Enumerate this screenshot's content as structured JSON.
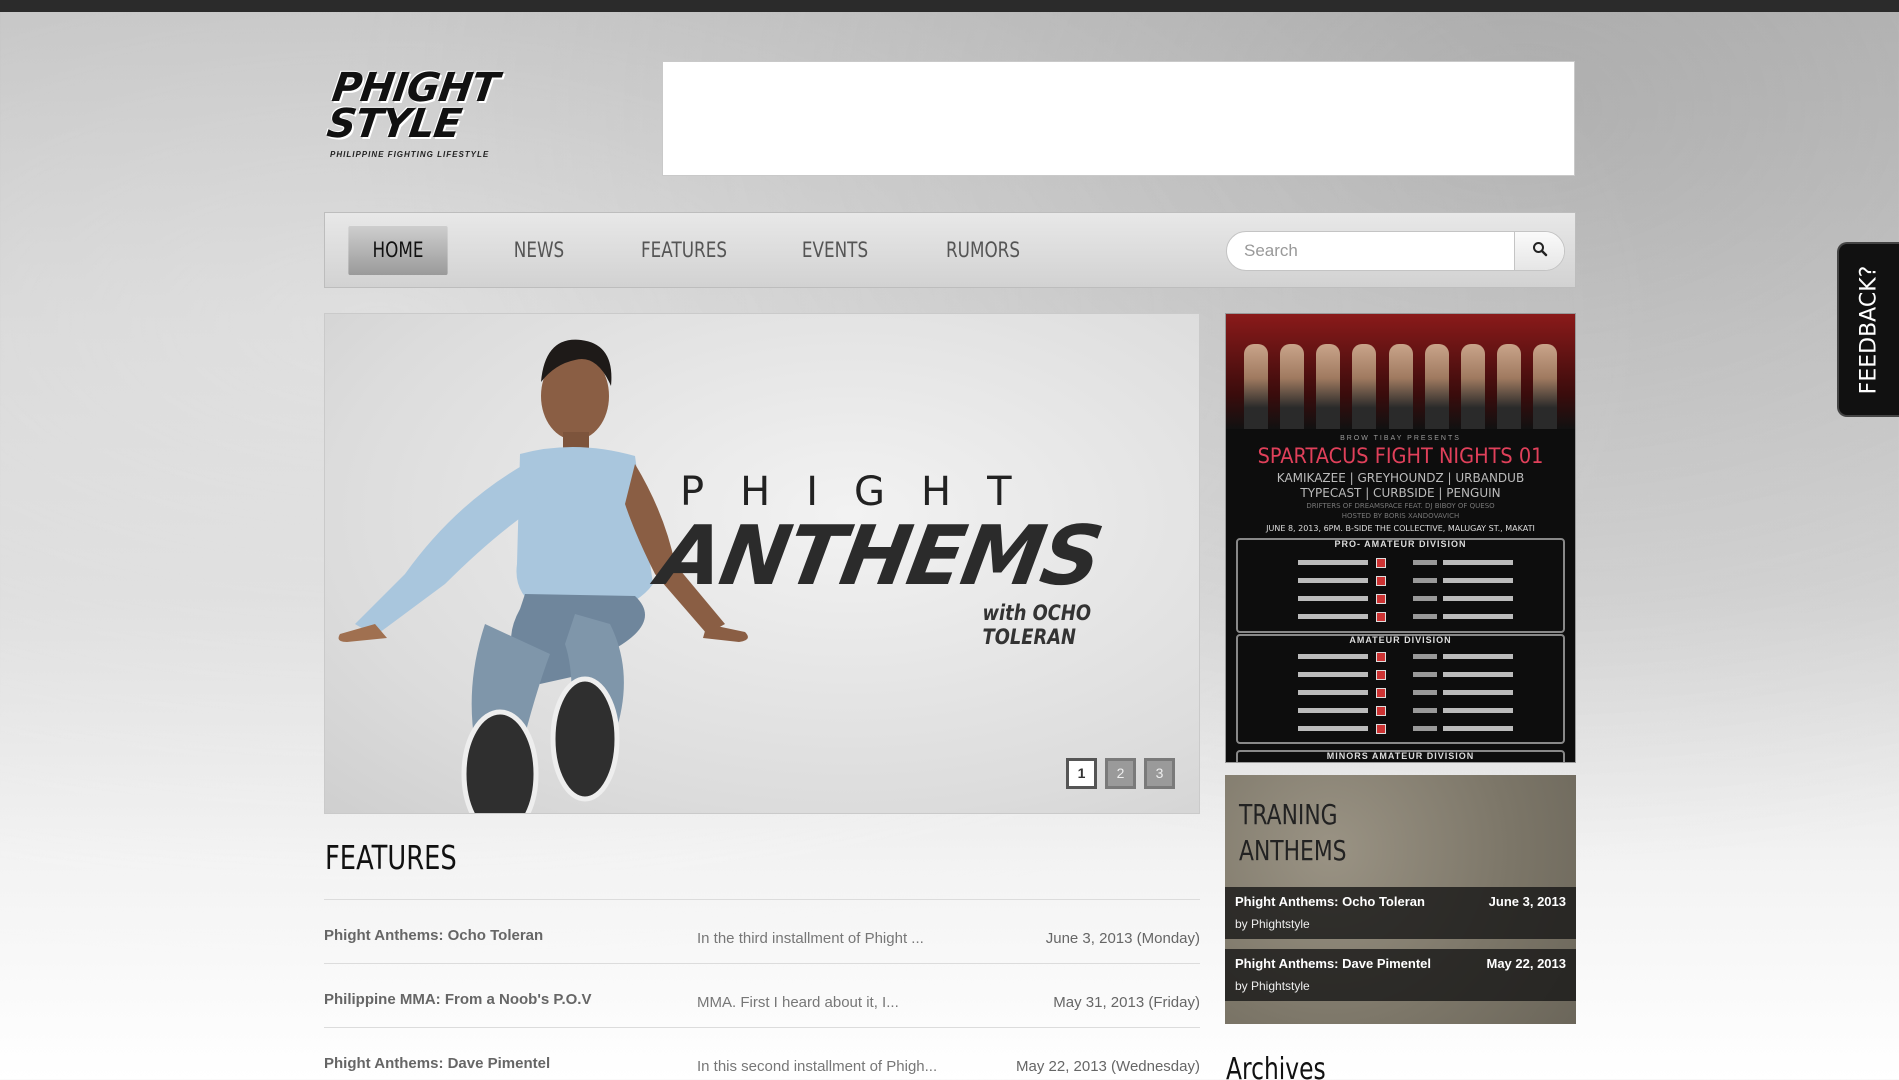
{
  "header": {
    "logo_text": "PHIGHT\nSTYLE",
    "logo_tagline": "PHILIPPINE FIGHTING LIFESTYLE"
  },
  "nav": {
    "items": [
      {
        "label": "HOME",
        "active": true
      },
      {
        "label": "NEWS",
        "active": false
      },
      {
        "label": "FEATURES",
        "active": false
      },
      {
        "label": "EVENTS",
        "active": false
      },
      {
        "label": "RUMORS",
        "active": false
      }
    ],
    "search": {
      "placeholder": "Search",
      "icon": "search-icon"
    }
  },
  "slider": {
    "headline_top": "PHIGHT",
    "headline_main": "ANTHEMS",
    "headline_sub": "with OCHO TOLERAN",
    "pages": [
      "1",
      "2",
      "3"
    ],
    "active_page": 1
  },
  "features": {
    "title": "FEATURES",
    "rows": [
      {
        "title": "Phight Anthems: Ocho Toleran",
        "excerpt": "In the third installment of Phight ...",
        "date": "June 3, 2013 (Monday)"
      },
      {
        "title": "Philippine MMA: From a Noob's P.O.V",
        "excerpt": "MMA. First I heard about it, I...",
        "date": "May 31, 2013 (Friday)"
      },
      {
        "title": "Phight Anthems: Dave Pimentel",
        "excerpt": "In this second installment of Phigh...",
        "date": "May 22, 2013 (Wednesday)"
      }
    ]
  },
  "poster": {
    "presents": "BROW TIBAY PRESENTS",
    "title": "SPARTACUS FIGHT NIGHTS 01",
    "bands_line1": "KAMIKAZEE | GREYHOUNDZ | URBANDUB",
    "bands_line2": "TYPECAST | CURBSIDE | PENGUIN",
    "drifters": "DRIFTERS OF DREAMSPACE FEAT. DJ BIBOY OF QUESO",
    "host": "HOSTED BY BORIS XANDOVAVICH",
    "venue": "JUNE 8, 2013, 6PM. B-SIDE THE COLLECTIVE, MALUGAY ST., MAKATI",
    "div1": "PRO- AMATEUR DIVISION",
    "div2": "AMATEUR DIVISION",
    "div3": "MINORS AMATEUR DIVISION"
  },
  "training": {
    "title": "TRANING\nANTHEMS",
    "items": [
      {
        "title": "Phight Anthems: Ocho Toleran",
        "date": "June 3, 2013",
        "byline": "by Phightstyle"
      },
      {
        "title": "Phight Anthems: Dave Pimentel",
        "date": "May 22, 2013",
        "byline": "by Phightstyle"
      }
    ]
  },
  "archives": {
    "title": "Archives"
  },
  "feedback": {
    "label": "FEEDBACK?"
  }
}
